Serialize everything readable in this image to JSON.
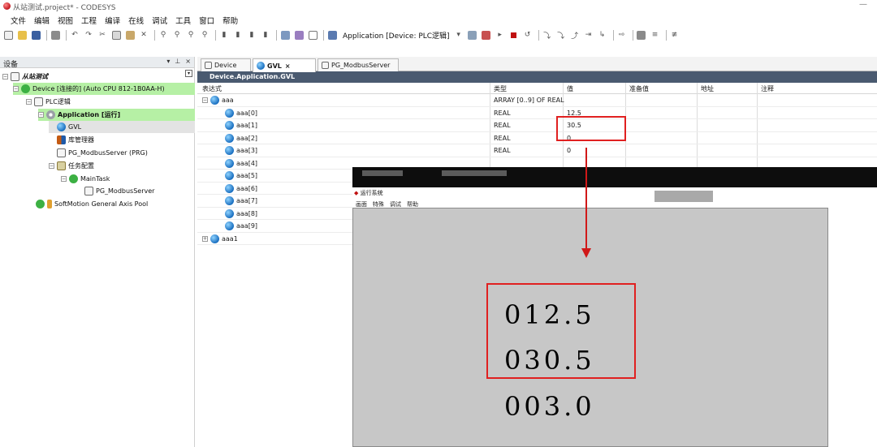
{
  "window": {
    "title": "从站测试.project* - CODESYS",
    "minimize": "—"
  },
  "menu": [
    "文件",
    "编辑",
    "视图",
    "工程",
    "编译",
    "在线",
    "调试",
    "工具",
    "窗口",
    "帮助"
  ],
  "toolbar": {
    "application_label": "Application [Device: PLC逻辑]"
  },
  "devices_panel": {
    "title": "设备",
    "controls": [
      "▾",
      "⊥",
      "×"
    ],
    "tree": [
      {
        "label": "从站测试",
        "level": 0
      },
      {
        "label": "Device [连接的] (Auto CPU 812-1B0AA-H)",
        "level": 1
      },
      {
        "label": "PLC逻辑",
        "level": 2
      },
      {
        "label": "Application [运行]",
        "level": 3
      },
      {
        "label": "GVL",
        "level": 4
      },
      {
        "label": "库管理器",
        "level": 4
      },
      {
        "label": "PG_ModbusServer (PRG)",
        "level": 4
      },
      {
        "label": "任务配置",
        "level": 4
      },
      {
        "label": "MainTask",
        "level": 5
      },
      {
        "label": "PG_ModbusServer",
        "level": 6
      },
      {
        "label": "SoftMotion General Axis Pool",
        "level": 2
      }
    ]
  },
  "tabs": [
    {
      "label": "Device"
    },
    {
      "label": "GVL",
      "close": "×"
    },
    {
      "label": "PG_ModbusServer"
    }
  ],
  "editor": {
    "doc_title": "Device.Application.GVL",
    "columns": [
      "表达式",
      "类型",
      "值",
      "准备值",
      "地址",
      "注释"
    ],
    "rows": [
      {
        "expr": "aaa",
        "type": "ARRAY [0..9] OF REAL",
        "value": ""
      },
      {
        "expr": "aaa[0]",
        "type": "REAL",
        "value": "12.5"
      },
      {
        "expr": "aaa[1]",
        "type": "REAL",
        "value": "30.5"
      },
      {
        "expr": "aaa[2]",
        "type": "REAL",
        "value": "0"
      },
      {
        "expr": "aaa[3]",
        "type": "REAL",
        "value": "0"
      },
      {
        "expr": "aaa[4]",
        "type": "",
        "value": ""
      },
      {
        "expr": "aaa[5]",
        "type": "",
        "value": ""
      },
      {
        "expr": "aaa[6]",
        "type": "",
        "value": ""
      },
      {
        "expr": "aaa[7]",
        "type": "",
        "value": ""
      },
      {
        "expr": "aaa[8]",
        "type": "",
        "value": ""
      },
      {
        "expr": "aaa[9]",
        "type": "",
        "value": ""
      },
      {
        "expr": "aaa1",
        "type": "",
        "value": ""
      }
    ]
  },
  "runtime_window": {
    "title": "运行系统",
    "menu": [
      "画面",
      "特殊",
      "调试",
      "帮助"
    ],
    "values": [
      "012.5",
      "030.5",
      "003.0"
    ]
  },
  "colors": {
    "highlight_green": "#b6f0a5",
    "annotation_red": "#e02020",
    "doc_header": "#4a5a70",
    "hmi_background": "#c7c7c7"
  }
}
